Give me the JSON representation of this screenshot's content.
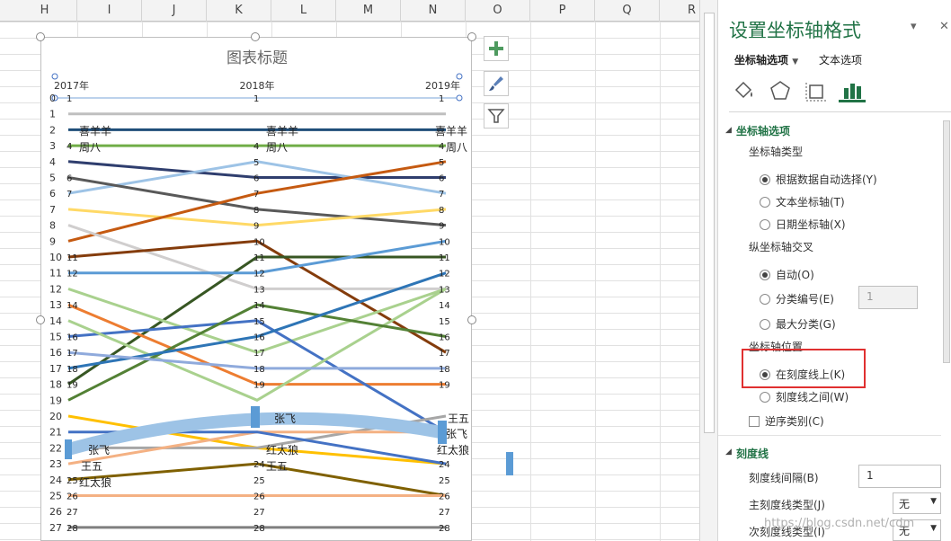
{
  "sheet": {
    "columns": [
      "H",
      "I",
      "J",
      "K",
      "L",
      "M",
      "N",
      "O",
      "P",
      "Q",
      "R"
    ]
  },
  "chart": {
    "title": "图表标题",
    "years": [
      "2017年",
      "2018年",
      "2019年"
    ],
    "row_labels": [
      "0",
      "1",
      "2",
      "3",
      "4",
      "5",
      "6",
      "7",
      "8",
      "9",
      "10",
      "11",
      "12",
      "13",
      "14",
      "15",
      "16",
      "17",
      "18",
      "19",
      "20",
      "21",
      "22",
      "23",
      "24",
      "25",
      "26",
      "27"
    ],
    "point_labels": {
      "left": [
        "1",
        "4",
        "6",
        "7",
        "11",
        "12",
        "14",
        "16",
        "17",
        "18",
        "19",
        "25",
        "26",
        "27",
        "28"
      ],
      "mid": [
        "1",
        "4",
        "5",
        "6",
        "7",
        "8",
        "9",
        "10",
        "11",
        "12",
        "13",
        "14",
        "15",
        "16",
        "17",
        "18",
        "19",
        "24",
        "25",
        "26",
        "27",
        "28"
      ],
      "right": [
        "1",
        "4",
        "5",
        "6",
        "7",
        "8",
        "9",
        "10",
        "11",
        "12",
        "13",
        "14",
        "15",
        "16",
        "17",
        "18",
        "19",
        "24",
        "25",
        "26",
        "27",
        "28"
      ]
    },
    "names": {
      "xiyangyang": "喜羊羊",
      "zhouba": "周八",
      "zhangfei": "张飞",
      "wangwu": "王五",
      "hongtailang": "红太狼"
    },
    "series_colors": [
      "#1f4e79",
      "#70ad47",
      "#2f3e6e",
      "#9dc3e6",
      "#595959",
      "#ffd966",
      "#c55a11",
      "#ccc",
      "#843c0c",
      "#375623",
      "#5b9bd5",
      "#a9d18e",
      "#ed7d31",
      "#4472c4",
      "#70ad47",
      "#8faadc",
      "#538135",
      "#2e75b6",
      "#ffc000",
      "#7f6000",
      "#f4b183"
    ]
  },
  "side_buttons": {
    "add": "chart-elements-icon",
    "style": "brush-icon",
    "filter": "filter-icon"
  },
  "pane": {
    "title": "设置坐标轴格式",
    "tab1": "坐标轴选项",
    "tab2": "文本选项",
    "section1": "坐标轴选项",
    "axis_type_label": "坐标轴类型",
    "axis_type_options": [
      "根据数据自动选择(Y)",
      "文本坐标轴(T)",
      "日期坐标轴(X)"
    ],
    "cross_label": "纵坐标轴交叉",
    "cross_options": [
      "自动(O)",
      "分类编号(E)",
      "最大分类(G)"
    ],
    "cross_value": "1",
    "position_label": "坐标轴位置",
    "position_options": [
      "在刻度线上(K)",
      "刻度线之间(W)"
    ],
    "reverse_label": "逆序类别(C)",
    "section2": "刻度线",
    "tick_interval_label": "刻度线间隔(B)",
    "tick_interval_value": "1",
    "major_tick_label": "主刻度线类型(J)",
    "major_tick_value": "无",
    "minor_tick_label": "次刻度线类型(I)",
    "minor_tick_value": "无"
  },
  "watermark": "https://blog.csdn.net/cdm"
}
